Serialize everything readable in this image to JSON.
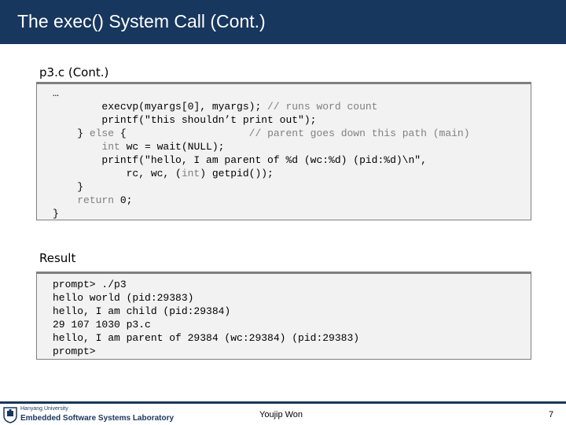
{
  "header": {
    "title": "The exec() System Call (Cont.)"
  },
  "section1": {
    "label": "p3.c (Cont.)",
    "code": [
      [
        {
          "t": "…",
          "c": "txt"
        }
      ],
      [
        {
          "t": "        execvp(myargs[0], myargs); ",
          "c": "txt"
        },
        {
          "t": "// runs word count",
          "c": "cm"
        }
      ],
      [
        {
          "t": "        printf(\"this shouldn’t print out\");",
          "c": "txt"
        }
      ],
      [
        {
          "t": "    } ",
          "c": "txt"
        },
        {
          "t": "else",
          "c": "kw"
        },
        {
          "t": " {                    ",
          "c": "txt"
        },
        {
          "t": "// parent goes down this path (main)",
          "c": "cm"
        }
      ],
      [
        {
          "t": "        ",
          "c": "txt"
        },
        {
          "t": "int",
          "c": "kw"
        },
        {
          "t": " wc = wait(NULL);",
          "c": "txt"
        }
      ],
      [
        {
          "t": "        printf(\"hello, I am parent of %d (wc:%d) (pid:%d)\\n\",",
          "c": "txt"
        }
      ],
      [
        {
          "t": "            rc, wc, (",
          "c": "txt"
        },
        {
          "t": "int",
          "c": "kw"
        },
        {
          "t": ") getpid());",
          "c": "txt"
        }
      ],
      [
        {
          "t": "    }",
          "c": "txt"
        }
      ],
      [
        {
          "t": "    ",
          "c": "txt"
        },
        {
          "t": "return",
          "c": "kw"
        },
        {
          "t": " 0;",
          "c": "txt"
        }
      ],
      [
        {
          "t": "}",
          "c": "txt"
        }
      ]
    ]
  },
  "section2": {
    "label": "Result",
    "code": [
      [
        {
          "t": "prompt> ./p3",
          "c": "txt"
        }
      ],
      [
        {
          "t": "hello world (pid:29383)",
          "c": "txt"
        }
      ],
      [
        {
          "t": "hello, I am child (pid:29384)",
          "c": "txt"
        }
      ],
      [
        {
          "t": "29 107 1030 p3.c",
          "c": "txt"
        }
      ],
      [
        {
          "t": "hello, I am parent of 29384 (wc:29384) (pid:29383)",
          "c": "txt"
        }
      ],
      [
        {
          "t": "prompt>",
          "c": "txt"
        }
      ]
    ]
  },
  "footer": {
    "university": "Hanyang University",
    "lab": "Embedded Software Systems Laboratory",
    "author": "Youjip Won",
    "page": "7",
    "logo_icon": "university-seal-icon"
  },
  "colors": {
    "header_bg": "#17375e",
    "code_bg": "#f2f2f2",
    "keyword": "#7f7f7f"
  }
}
